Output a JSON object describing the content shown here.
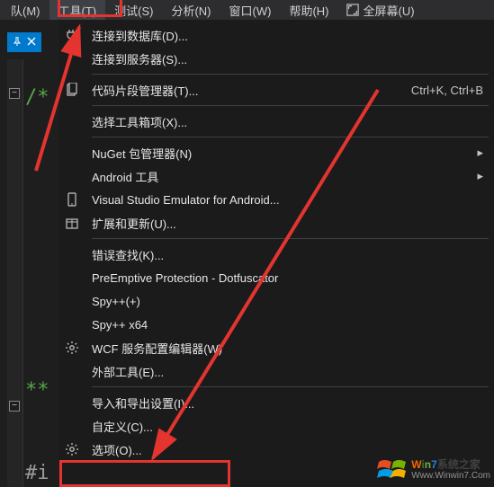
{
  "menubar": {
    "items": [
      {
        "label": "队(M)"
      },
      {
        "label": "工具(T)",
        "active": true
      },
      {
        "label": "测试(S)"
      },
      {
        "label": "分析(N)"
      },
      {
        "label": "窗口(W)"
      },
      {
        "label": "帮助(H)"
      },
      {
        "label": "全屏幕(U)",
        "icon": "fullscreen"
      }
    ]
  },
  "dropdown": {
    "groups": [
      [
        {
          "icon": "plug",
          "label": "连接到数据库(D)..."
        },
        {
          "icon": "",
          "label": "连接到服务器(S)..."
        }
      ],
      [
        {
          "icon": "doc",
          "label": "代码片段管理器(T)...",
          "shortcut": "Ctrl+K, Ctrl+B"
        }
      ],
      [
        {
          "icon": "",
          "label": "选择工具箱项(X)..."
        }
      ],
      [
        {
          "icon": "",
          "label": "NuGet 包管理器(N)",
          "submenu": true
        },
        {
          "icon": "",
          "label": "Android 工具",
          "submenu": true
        },
        {
          "icon": "phone",
          "label": "Visual Studio Emulator for Android..."
        },
        {
          "icon": "pkg",
          "label": "扩展和更新(U)..."
        }
      ],
      [
        {
          "icon": "",
          "label": "错误查找(K)..."
        },
        {
          "icon": "",
          "label": "PreEmptive Protection - Dotfuscator"
        },
        {
          "icon": "",
          "label": "Spy++(+)"
        },
        {
          "icon": "",
          "label": "Spy++ x64"
        },
        {
          "icon": "gear",
          "label": "WCF 服务配置编辑器(W)"
        },
        {
          "icon": "",
          "label": "外部工具(E)..."
        }
      ],
      [
        {
          "icon": "",
          "label": "导入和导出设置(I)..."
        },
        {
          "icon": "",
          "label": "自定义(C)..."
        },
        {
          "icon": "gear",
          "label": "选项(O)..."
        }
      ]
    ]
  },
  "editor": {
    "comment1": "/*",
    "comment2": "**",
    "pragma": "#i"
  },
  "watermark": {
    "line1": "Win7系统之家",
    "line2": "Www.Winwin7.Com"
  }
}
